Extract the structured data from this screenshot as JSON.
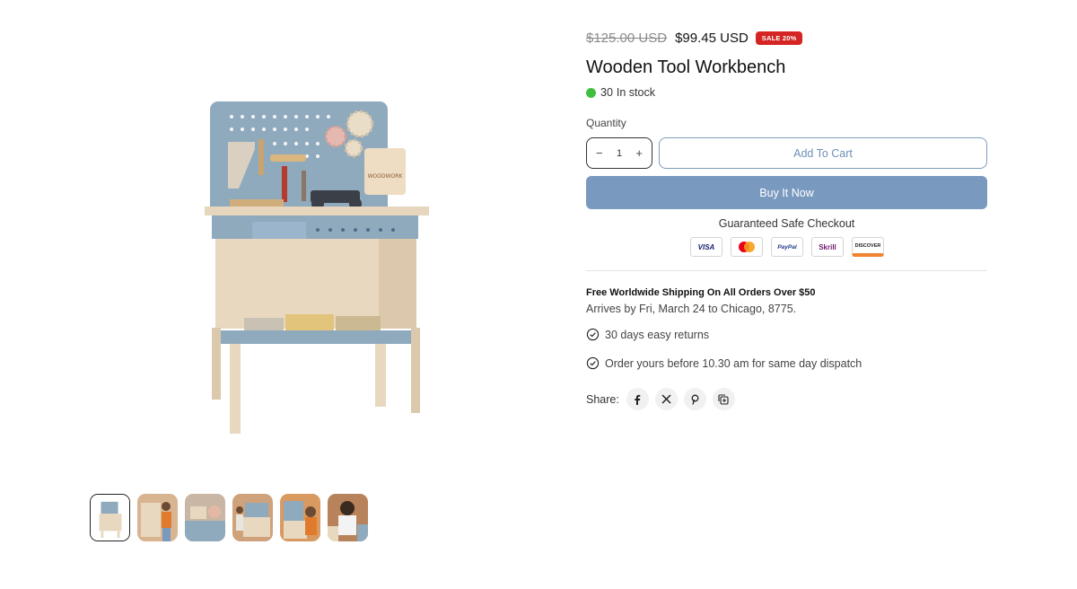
{
  "product": {
    "price_old": "$125.00 USD",
    "price_new": "$99.45 USD",
    "sale_badge": "SALE 20%",
    "title": "Wooden Tool Workbench",
    "stock_count": "30",
    "stock_text": "In stock",
    "stock_color": "#3fbf3f"
  },
  "purchase": {
    "quantity_label": "Quantity",
    "quantity_value": "1",
    "minus": "−",
    "plus": "+",
    "add_to_cart": "Add To Cart",
    "buy_now": "Buy It Now",
    "accent_color": "#7a99bf"
  },
  "checkout": {
    "title": "Guaranteed Safe Checkout",
    "payments": [
      "VISA",
      "Mastercard",
      "PayPal",
      "Skrill",
      "DISCOVER"
    ]
  },
  "shipping": {
    "title": "Free Worldwide Shipping On All Orders Over $50",
    "arrival": "Arrives by Fri, March 24 to Chicago, 8775."
  },
  "features": [
    "30 days easy returns",
    "Order yours before 10.30 am for same day dispatch"
  ],
  "share": {
    "label": "Share:",
    "icons": [
      "facebook-icon",
      "x-icon",
      "pinterest-icon",
      "copy-link-icon"
    ]
  },
  "gallery": {
    "thumbnails": [
      "thumbnail-1",
      "thumbnail-2",
      "thumbnail-3",
      "thumbnail-4",
      "thumbnail-5",
      "thumbnail-6"
    ]
  }
}
